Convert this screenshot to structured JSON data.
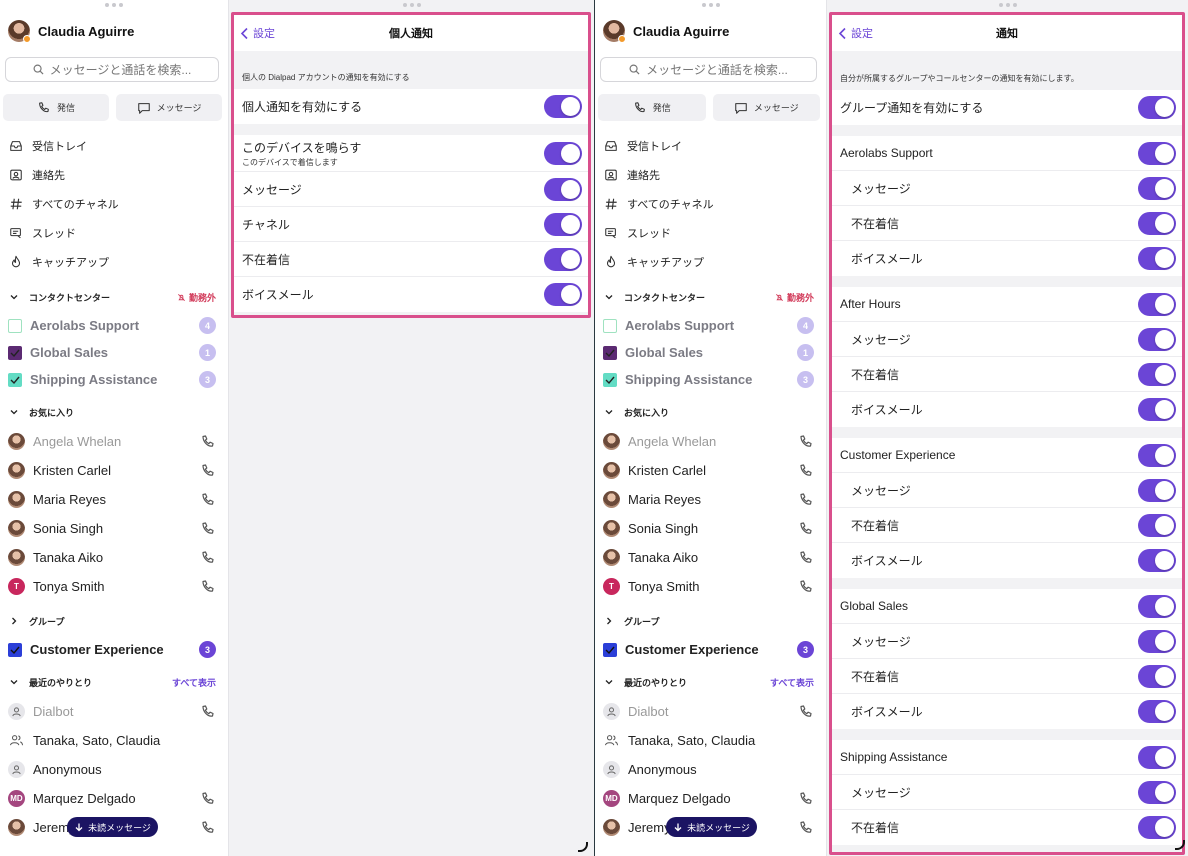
{
  "user": {
    "name": "Claudia  Aguirre"
  },
  "search": {
    "placeholder": "メッセージと通話を検索..."
  },
  "quick_actions": {
    "call": "発信",
    "message": "メッセージ"
  },
  "nav": [
    "受信トレイ",
    "連絡先",
    "すべてのチャネル",
    "スレッド",
    "キャッチアップ"
  ],
  "contact_center": {
    "title": "コンタクトセンター",
    "status": "勤務外",
    "items": [
      {
        "label": "Aerolabs Support",
        "count": "4"
      },
      {
        "label": "Global Sales",
        "count": "1"
      },
      {
        "label": "Shipping Assistance",
        "count": "3"
      }
    ]
  },
  "favorites": {
    "title": "お気に入り",
    "items": [
      "Angela Whelan",
      "Kristen Carlel",
      "Maria Reyes",
      "Sonia  Singh",
      "Tanaka Aiko",
      "Tonya Smith"
    ],
    "tonya_initial": "T"
  },
  "groups": {
    "title": "グループ",
    "items": [
      {
        "label": "Customer Experience",
        "count": "3"
      }
    ]
  },
  "recent": {
    "title": "最近のやりとり",
    "show_all": "すべて表示",
    "items": [
      "Dialbot",
      "Tanaka, Sato, Claudia",
      "Anonymous",
      "Marquez Delgado",
      "Jeremy Withers"
    ],
    "marquez_initials": "MD"
  },
  "unread_button": "未読メッセージ",
  "left_panel": {
    "back": "設定",
    "title": "個人通知",
    "hint": "個人の Dialpad アカウントの通知を有効にする",
    "enable_label": "個人通知を有効にする",
    "ring_label": "このデバイスを鳴らす",
    "ring_sub": "このデバイスで着信します",
    "items": [
      "メッセージ",
      "チャネル",
      "不在着信",
      "ボイスメール"
    ]
  },
  "right_panel": {
    "back": "設定",
    "title": "通知",
    "hint": "自分が所属するグループやコールセンターの通知を有効にします。",
    "enable_label": "グループ通知を有効にする",
    "groups": [
      {
        "name": "Aerolabs Support",
        "items": [
          "メッセージ",
          "不在着信",
          "ボイスメール"
        ]
      },
      {
        "name": "After Hours",
        "items": [
          "メッセージ",
          "不在着信",
          "ボイスメール"
        ]
      },
      {
        "name": "Customer Experience",
        "items": [
          "メッセージ",
          "不在着信",
          "ボイスメール"
        ]
      },
      {
        "name": "Global Sales",
        "items": [
          "メッセージ",
          "不在着信",
          "ボイスメール"
        ]
      },
      {
        "name": "Shipping Assistance",
        "items": [
          "メッセージ",
          "不在着信"
        ]
      }
    ]
  },
  "colors": {
    "accent": "#6b45d6",
    "highlight": "#d94f8c",
    "unread_pill": "#1b1463"
  }
}
